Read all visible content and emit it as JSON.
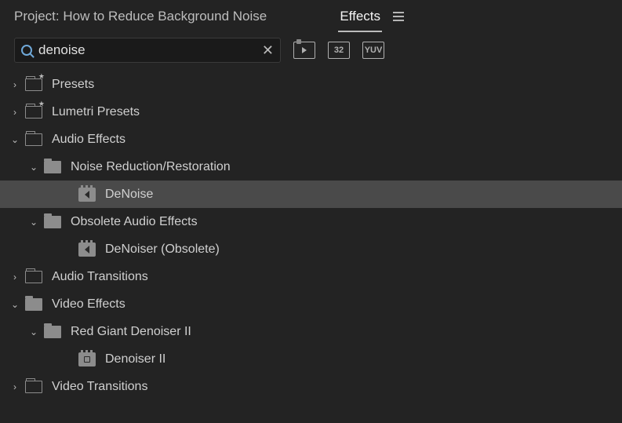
{
  "header": {
    "project_title": "Project: How to Reduce Background Noise",
    "active_tab": "Effects"
  },
  "search": {
    "value": "denoise",
    "badge1": "32",
    "badge2": "YUV"
  },
  "tree": [
    {
      "id": "presets",
      "label": "Presets",
      "depth": 0,
      "exp": "closed",
      "icon": "bin-star"
    },
    {
      "id": "lumetri",
      "label": "Lumetri Presets",
      "depth": 0,
      "exp": "closed",
      "icon": "bin-star"
    },
    {
      "id": "audio-fx",
      "label": "Audio Effects",
      "depth": 0,
      "exp": "open",
      "icon": "bin"
    },
    {
      "id": "noise-red",
      "label": "Noise Reduction/Restoration",
      "depth": 1,
      "exp": "open",
      "icon": "folder"
    },
    {
      "id": "denoise",
      "label": "DeNoise",
      "depth": 2,
      "exp": "none",
      "icon": "fx-audio",
      "selected": true
    },
    {
      "id": "obsolete",
      "label": "Obsolete Audio Effects",
      "depth": 1,
      "exp": "open",
      "icon": "folder"
    },
    {
      "id": "denoiser-obs",
      "label": "DeNoiser (Obsolete)",
      "depth": 2,
      "exp": "none",
      "icon": "fx-audio"
    },
    {
      "id": "audio-trans",
      "label": "Audio Transitions",
      "depth": 0,
      "exp": "closed",
      "icon": "bin"
    },
    {
      "id": "video-fx",
      "label": "Video Effects",
      "depth": 0,
      "exp": "open",
      "icon": "folder"
    },
    {
      "id": "redgiant",
      "label": "Red Giant Denoiser II",
      "depth": 1,
      "exp": "open",
      "icon": "folder"
    },
    {
      "id": "denoiser2",
      "label": "Denoiser II",
      "depth": 2,
      "exp": "none",
      "icon": "fx-video"
    },
    {
      "id": "video-trans",
      "label": "Video Transitions",
      "depth": 0,
      "exp": "closed",
      "icon": "bin"
    }
  ]
}
